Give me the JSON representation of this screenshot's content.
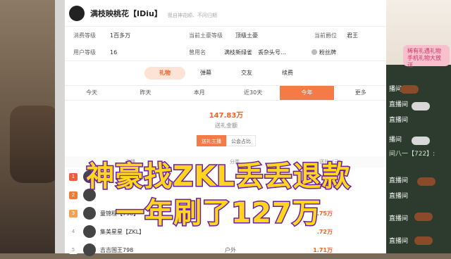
{
  "header": {
    "name": "满枝映桃花【IDiu】",
    "signature": "我自神花顺、不问归期"
  },
  "info": {
    "row1": [
      {
        "label": "消费等级",
        "value": "1百多万"
      },
      {
        "label": "当前土豪等级",
        "value": "顶级土豪"
      },
      {
        "label": "当前爵位",
        "value": "君王"
      }
    ],
    "row2": [
      {
        "label": "用户等级",
        "value": "16"
      },
      {
        "label": "曾用名",
        "value": "满枝新绿雀　丢杂头号…"
      },
      {
        "label": "",
        "value": "粉丝牌"
      }
    ]
  },
  "tabs": [
    {
      "label": "礼物",
      "active": true
    },
    {
      "label": "弹幕",
      "active": false
    },
    {
      "label": "交友",
      "active": false
    },
    {
      "label": "续费",
      "active": false
    }
  ],
  "ranges": [
    {
      "label": "今天",
      "active": false
    },
    {
      "label": "昨天",
      "active": false
    },
    {
      "label": "本月",
      "active": false
    },
    {
      "label": "近30天",
      "active": false
    },
    {
      "label": "今年",
      "active": true
    },
    {
      "label": "更多",
      "active": false
    }
  ],
  "total": {
    "amount": "147.83万",
    "label": "送礼金额"
  },
  "switch": [
    {
      "label": "送礼主播",
      "active": true
    },
    {
      "label": "公会占比",
      "active": false
    }
  ],
  "table": {
    "headers": [
      "主播",
      "分类",
      "送礼（元）"
    ],
    "rows": [
      {
        "rank": "1",
        "name": "",
        "category": "",
        "amount": ""
      },
      {
        "rank": "2",
        "name": "",
        "category": "",
        "amount": ""
      },
      {
        "rank": "3",
        "name": "童锦程【798】",
        "category": "",
        "amount": ".75万"
      },
      {
        "rank": "4",
        "name": "集美星星【ZKL】",
        "category": "",
        "amount": ".72万"
      },
      {
        "rank": "5",
        "name": "吉吉国王798",
        "category": "户外",
        "amount": "1.71万"
      }
    ]
  },
  "captions": {
    "line1": "神豪找ZKL丢丢退款",
    "line2": "一年刷了127万"
  },
  "live_panel": {
    "badge": "稀有礼遇礼物 手机礼物大放送",
    "lines": [
      "播间",
      "直播间",
      "直播间",
      "播间",
      "间八一【722】:",
      "直播间",
      "直播间",
      "直播间",
      "直播间"
    ]
  },
  "colors": {
    "accent": "#f47b46",
    "caption_fill": "#ffd51e",
    "caption_stroke": "#6a1fa8"
  }
}
